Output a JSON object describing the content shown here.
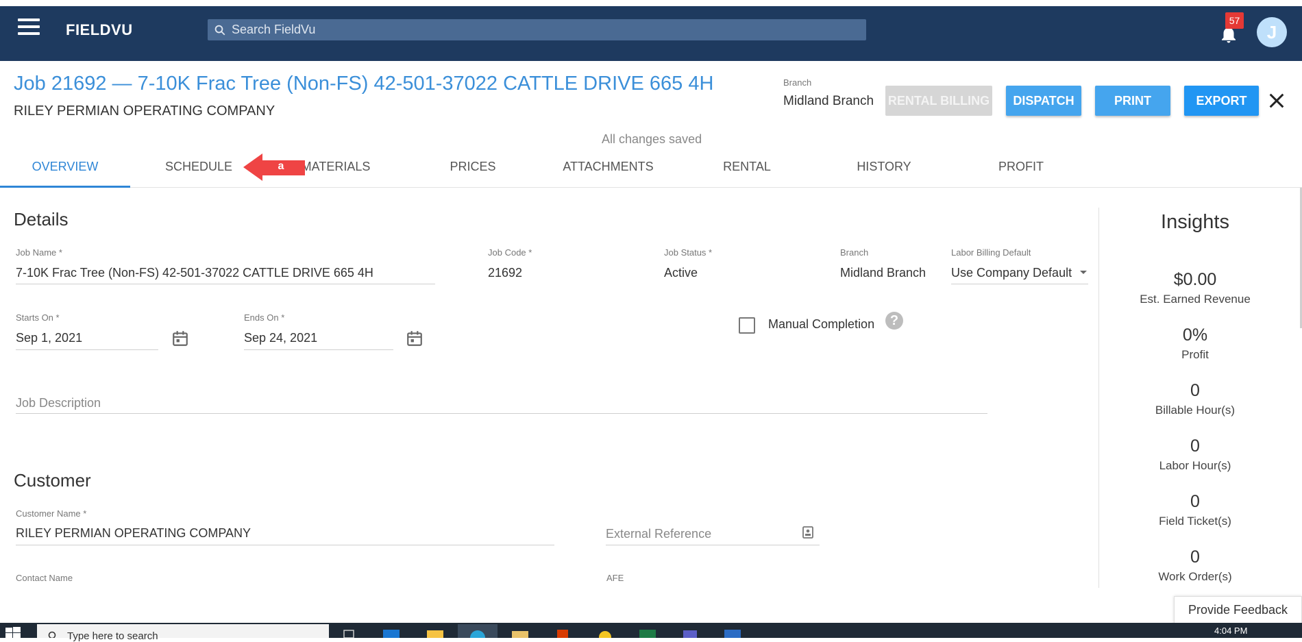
{
  "app": {
    "brand": "FIELDVU",
    "search_placeholder": "Search FieldVu",
    "notification_count": "57",
    "avatar_initial": "J"
  },
  "header": {
    "title": "Job 21692 — 7-10K Frac Tree (Non-FS) 42-501-37022 CATTLE DRIVE 665 4H",
    "company": "RILEY PERMIAN OPERATING COMPANY",
    "branch_label": "Branch",
    "branch_value": "Midland Branch",
    "buttons": {
      "rental_billing": "RENTAL BILLING",
      "dispatch": "DISPATCH",
      "print": "PRINT",
      "export": "EXPORT"
    },
    "save_status": "All changes saved"
  },
  "tabs": [
    {
      "label": "OVERVIEW"
    },
    {
      "label": "SCHEDULE"
    },
    {
      "label": "MATERIALS"
    },
    {
      "label": "PRICES"
    },
    {
      "label": "ATTACHMENTS"
    },
    {
      "label": "RENTAL"
    },
    {
      "label": "HISTORY"
    },
    {
      "label": "PROFIT"
    }
  ],
  "annotation": {
    "label": "a"
  },
  "details": {
    "title": "Details",
    "job_name_label": "Job Name *",
    "job_name": "7-10K Frac Tree (Non-FS)  42-501-37022 CATTLE DRIVE 665 4H",
    "job_code_label": "Job Code *",
    "job_code": "21692",
    "job_status_label": "Job Status *",
    "job_status": "Active",
    "branch_label": "Branch",
    "branch": "Midland Branch",
    "labor_billing_label": "Labor Billing Default",
    "labor_billing": "Use Company Default",
    "starts_on_label": "Starts On *",
    "starts_on": "Sep 1, 2021",
    "ends_on_label": "Ends On *",
    "ends_on": "Sep 24, 2021",
    "manual_completion": "Manual Completion",
    "help_glyph": "?",
    "job_description_placeholder": "Job Description"
  },
  "customer": {
    "title": "Customer",
    "customer_name_label": "Customer Name *",
    "customer_name": "RILEY PERMIAN OPERATING COMPANY",
    "external_reference_placeholder": "External Reference",
    "contact_name_label": "Contact Name",
    "afe_label": "AFE"
  },
  "insights": {
    "title": "Insights",
    "items": [
      {
        "value": "$0.00",
        "label": "Est. Earned Revenue"
      },
      {
        "value": "0%",
        "label": "Profit"
      },
      {
        "value": "0",
        "label": "Billable Hour(s)"
      },
      {
        "value": "0",
        "label": "Labor Hour(s)"
      },
      {
        "value": "0",
        "label": "Field Ticket(s)"
      },
      {
        "value": "0",
        "label": "Work Order(s)"
      }
    ]
  },
  "feedback": "Provide Feedback",
  "taskbar": {
    "search_text": "Type here to search",
    "clock": "4:04 PM"
  },
  "colors": {
    "appbar": "#1e3a5f",
    "accent": "#2f86d6",
    "button": "#45a5ee",
    "badge": "#e53935",
    "annotation_arrow": "#ef4444"
  }
}
